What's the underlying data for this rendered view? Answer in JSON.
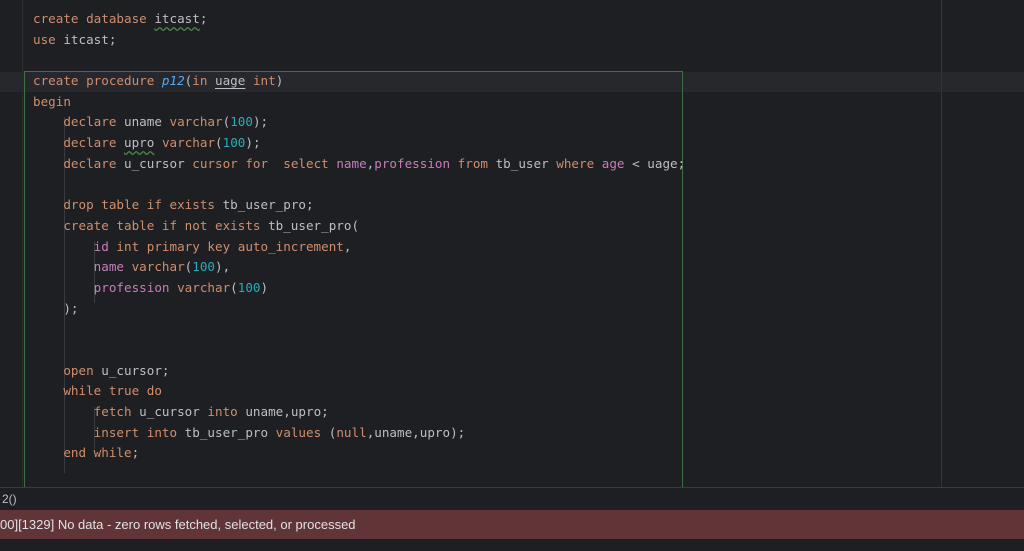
{
  "editor": {
    "lines": [
      [
        {
          "t": "create database ",
          "c": "kw"
        },
        {
          "t": "itcast",
          "c": "ul"
        },
        {
          "t": ";",
          "c": ""
        }
      ],
      [
        {
          "t": "use ",
          "c": "kw"
        },
        {
          "t": "itcast;",
          "c": ""
        }
      ],
      [
        {
          "t": "",
          "c": ""
        }
      ],
      [
        {
          "t": "create procedure ",
          "c": "kw"
        },
        {
          "t": "p12",
          "c": "fn"
        },
        {
          "t": "(",
          "c": ""
        },
        {
          "t": "in ",
          "c": "kw"
        },
        {
          "t": "uage",
          "c": "ul2"
        },
        {
          "t": " ",
          "c": ""
        },
        {
          "t": "int",
          "c": "kw"
        },
        {
          "t": ")",
          "c": ""
        }
      ],
      [
        {
          "t": "begin",
          "c": "kw"
        }
      ],
      [
        {
          "t": "    ",
          "c": ""
        },
        {
          "t": "declare ",
          "c": "kw"
        },
        {
          "t": "uname ",
          "c": ""
        },
        {
          "t": "varchar",
          "c": "kw"
        },
        {
          "t": "(",
          "c": ""
        },
        {
          "t": "100",
          "c": "num"
        },
        {
          "t": ");",
          "c": ""
        }
      ],
      [
        {
          "t": "    ",
          "c": ""
        },
        {
          "t": "declare ",
          "c": "kw"
        },
        {
          "t": "upro",
          "c": "ul"
        },
        {
          "t": " ",
          "c": ""
        },
        {
          "t": "varchar",
          "c": "kw"
        },
        {
          "t": "(",
          "c": ""
        },
        {
          "t": "100",
          "c": "num"
        },
        {
          "t": ");",
          "c": ""
        }
      ],
      [
        {
          "t": "    ",
          "c": ""
        },
        {
          "t": "declare ",
          "c": "kw"
        },
        {
          "t": "u_cursor ",
          "c": ""
        },
        {
          "t": "cursor for  select ",
          "c": "kw"
        },
        {
          "t": "name",
          "c": "col"
        },
        {
          "t": ",",
          "c": ""
        },
        {
          "t": "profession ",
          "c": "col"
        },
        {
          "t": "from ",
          "c": "kw"
        },
        {
          "t": "tb_user ",
          "c": ""
        },
        {
          "t": "where ",
          "c": "kw"
        },
        {
          "t": "age ",
          "c": "col"
        },
        {
          "t": "< uage;",
          "c": ""
        }
      ],
      [
        {
          "t": "",
          "c": ""
        }
      ],
      [
        {
          "t": "    ",
          "c": ""
        },
        {
          "t": "drop table if exists ",
          "c": "kw"
        },
        {
          "t": "tb_user_pro;",
          "c": ""
        }
      ],
      [
        {
          "t": "    ",
          "c": ""
        },
        {
          "t": "create table if not exists ",
          "c": "kw"
        },
        {
          "t": "tb_user_pro(",
          "c": ""
        }
      ],
      [
        {
          "t": "        ",
          "c": ""
        },
        {
          "t": "id ",
          "c": "col"
        },
        {
          "t": "int primary key auto_increment",
          "c": "kw"
        },
        {
          "t": ",",
          "c": ""
        }
      ],
      [
        {
          "t": "        ",
          "c": ""
        },
        {
          "t": "name ",
          "c": "col"
        },
        {
          "t": "varchar",
          "c": "kw"
        },
        {
          "t": "(",
          "c": ""
        },
        {
          "t": "100",
          "c": "num"
        },
        {
          "t": "),",
          "c": ""
        }
      ],
      [
        {
          "t": "        ",
          "c": ""
        },
        {
          "t": "profession ",
          "c": "col"
        },
        {
          "t": "varchar",
          "c": "kw"
        },
        {
          "t": "(",
          "c": ""
        },
        {
          "t": "100",
          "c": "num"
        },
        {
          "t": ")",
          "c": ""
        }
      ],
      [
        {
          "t": "    );",
          "c": ""
        }
      ],
      [
        {
          "t": "",
          "c": ""
        }
      ],
      [
        {
          "t": "",
          "c": ""
        }
      ],
      [
        {
          "t": "    ",
          "c": ""
        },
        {
          "t": "open ",
          "c": "kw"
        },
        {
          "t": "u_cursor;",
          "c": ""
        }
      ],
      [
        {
          "t": "    ",
          "c": ""
        },
        {
          "t": "while true do",
          "c": "kw"
        }
      ],
      [
        {
          "t": "        ",
          "c": ""
        },
        {
          "t": "fetch ",
          "c": "kw"
        },
        {
          "t": "u_cursor ",
          "c": ""
        },
        {
          "t": "into ",
          "c": "kw"
        },
        {
          "t": "uname,upro;",
          "c": ""
        }
      ],
      [
        {
          "t": "        ",
          "c": ""
        },
        {
          "t": "insert into ",
          "c": "kw"
        },
        {
          "t": "tb_user_pro ",
          "c": ""
        },
        {
          "t": "values ",
          "c": "kw"
        },
        {
          "t": "(",
          "c": ""
        },
        {
          "t": "null",
          "c": "kw"
        },
        {
          "t": ",uname,upro);",
          "c": ""
        }
      ],
      [
        {
          "t": "    ",
          "c": ""
        },
        {
          "t": "end while",
          "c": "kw"
        },
        {
          "t": ";",
          "c": ""
        }
      ]
    ]
  },
  "status_line": "2()",
  "error_message": "00][1329] No data - zero rows fetched, selected, or processed",
  "colors": {
    "background": "#1e1f22",
    "keyword": "#cf8e6d",
    "function": "#56a8f5",
    "number": "#2aacb8",
    "column": "#c77dbb",
    "text": "#bcbec4",
    "error_bar": "#613537"
  }
}
